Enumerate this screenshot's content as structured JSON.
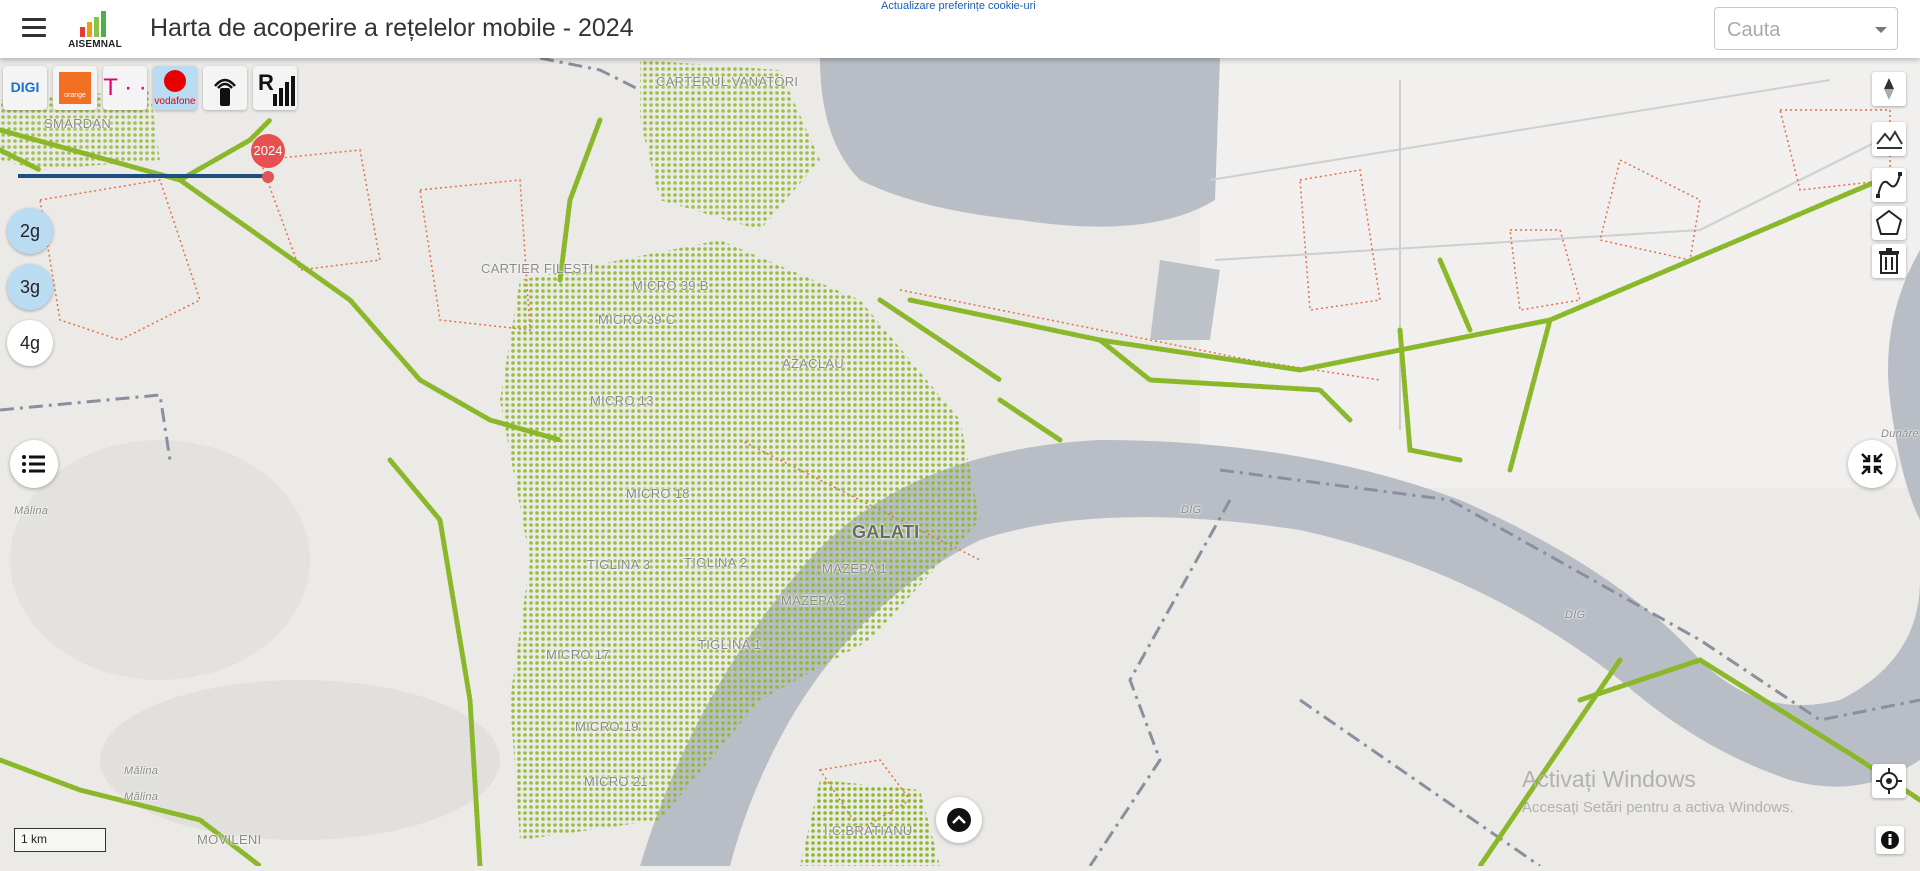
{
  "header": {
    "title": "Harta de acoperire a rețelelor mobile - 2024",
    "logo_text": "AISEMNAL",
    "cookie_link": "Actualizare preferințe cookie-uri",
    "search_placeholder": "Cauta"
  },
  "operators": [
    {
      "name": "digi",
      "label": "DIGI",
      "icon": "digi-logo",
      "active": false
    },
    {
      "name": "orange",
      "label": "orange",
      "icon": "orange-logo",
      "active": false
    },
    {
      "name": "telekom",
      "label": "T · ·",
      "icon": "telekom-logo",
      "active": false
    },
    {
      "name": "vodafone",
      "label": "vodafone",
      "icon": "vodafone-logo",
      "active": true
    },
    {
      "name": "antenna",
      "icon": "signal-tower-icon",
      "active": false
    },
    {
      "name": "roaming",
      "label": "R",
      "icon": "roaming-signal-icon",
      "active": false
    }
  ],
  "year_slider": {
    "value": "2024"
  },
  "generations": [
    {
      "label": "2g",
      "active": true
    },
    {
      "label": "3g",
      "active": true
    },
    {
      "label": "4g",
      "active": false
    }
  ],
  "map": {
    "city": "GALATI",
    "labels": [
      {
        "id": "carterul-vanatori",
        "text": "CARTERUL VANATORI"
      },
      {
        "id": "smardan",
        "text": "SMARDAN"
      },
      {
        "id": "cartier-filesti",
        "text": "CARTIER FILEȘTI"
      },
      {
        "id": "micro-39b",
        "text": "MICRO 39 B"
      },
      {
        "id": "micro-39c",
        "text": "MICRO 39 C"
      },
      {
        "id": "aziclau",
        "text": "AZACLAU"
      },
      {
        "id": "micro-13",
        "text": "MICRO 13"
      },
      {
        "id": "micro-18",
        "text": "MICRO 18"
      },
      {
        "id": "tiglina-3",
        "text": "TIGLINA 3"
      },
      {
        "id": "tiglina-2",
        "text": "TIGLINA 2"
      },
      {
        "id": "mazepa-1",
        "text": "MAZEPA 1"
      },
      {
        "id": "mazepa-2",
        "text": "MAZEPA 2"
      },
      {
        "id": "tiglina-1",
        "text": "TIGLINA 1"
      },
      {
        "id": "micro-17",
        "text": "MICRO 17"
      },
      {
        "id": "micro-19",
        "text": "MICRO 19"
      },
      {
        "id": "micro-21",
        "text": "MICRO 21"
      },
      {
        "id": "movileni",
        "text": "MOVILENI"
      },
      {
        "id": "ic-bratianu",
        "text": "I.C.BRATIANU"
      },
      {
        "id": "malina-1",
        "text": "Mălina"
      },
      {
        "id": "malina-2",
        "text": "Mălina"
      },
      {
        "id": "malina-3",
        "text": "Mălina"
      },
      {
        "id": "dig-1",
        "text": "DIG"
      },
      {
        "id": "dig-2",
        "text": "DIG"
      },
      {
        "id": "dunare",
        "text": "Dunăre"
      }
    ],
    "scale": "1 km",
    "colors": {
      "coverage": "#8bb82b",
      "river": "#b9bec6",
      "border": "#e0704a",
      "admin": "#8a8e9e"
    }
  },
  "watermark": {
    "line1": "Activați Windows",
    "line2": "Accesați Setări pentru a activa Windows."
  }
}
